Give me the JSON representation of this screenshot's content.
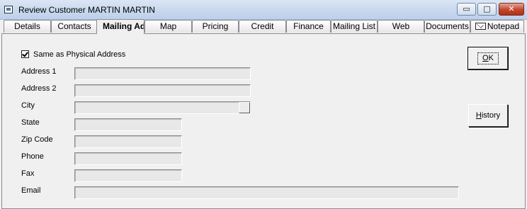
{
  "window": {
    "title": "Review Customer MARTIN MARTIN",
    "minimize_glyph": "▭",
    "maximize_glyph": "□",
    "close_glyph": "✕"
  },
  "tabs": [
    {
      "label": "Details"
    },
    {
      "label": "Contacts"
    },
    {
      "label": "Mailing Address"
    },
    {
      "label": "Map"
    },
    {
      "label": "Pricing"
    },
    {
      "label": "Credit"
    },
    {
      "label": "Finance"
    },
    {
      "label": "Mailing List"
    },
    {
      "label": "Web"
    },
    {
      "label": "Documents"
    },
    {
      "label": "Notepad",
      "icon": "envelope-icon"
    }
  ],
  "active_tab": "Mailing Address",
  "form": {
    "same_as_physical_label": "Same as Physical Address",
    "same_as_physical_checked": true,
    "address1_label": "Address 1",
    "address1_value": "",
    "address2_label": "Address 2",
    "address2_value": "",
    "city_label": "City",
    "city_value": "",
    "state_label": "State",
    "state_value": "",
    "zip_label": "Zip Code",
    "zip_value": "",
    "phone_label": "Phone",
    "phone_value": "",
    "fax_label": "Fax",
    "fax_value": "",
    "email_label": "Email",
    "email_value": ""
  },
  "buttons": {
    "ok_mnemonic": "O",
    "ok_rest": "K",
    "history_mnemonic": "H",
    "history_rest": "istory"
  },
  "colors": {
    "titlebar": "#c9d9ee",
    "close_button": "#c4432d",
    "field_disabled": "#e8e8e8",
    "face": "#f0f0f0"
  }
}
